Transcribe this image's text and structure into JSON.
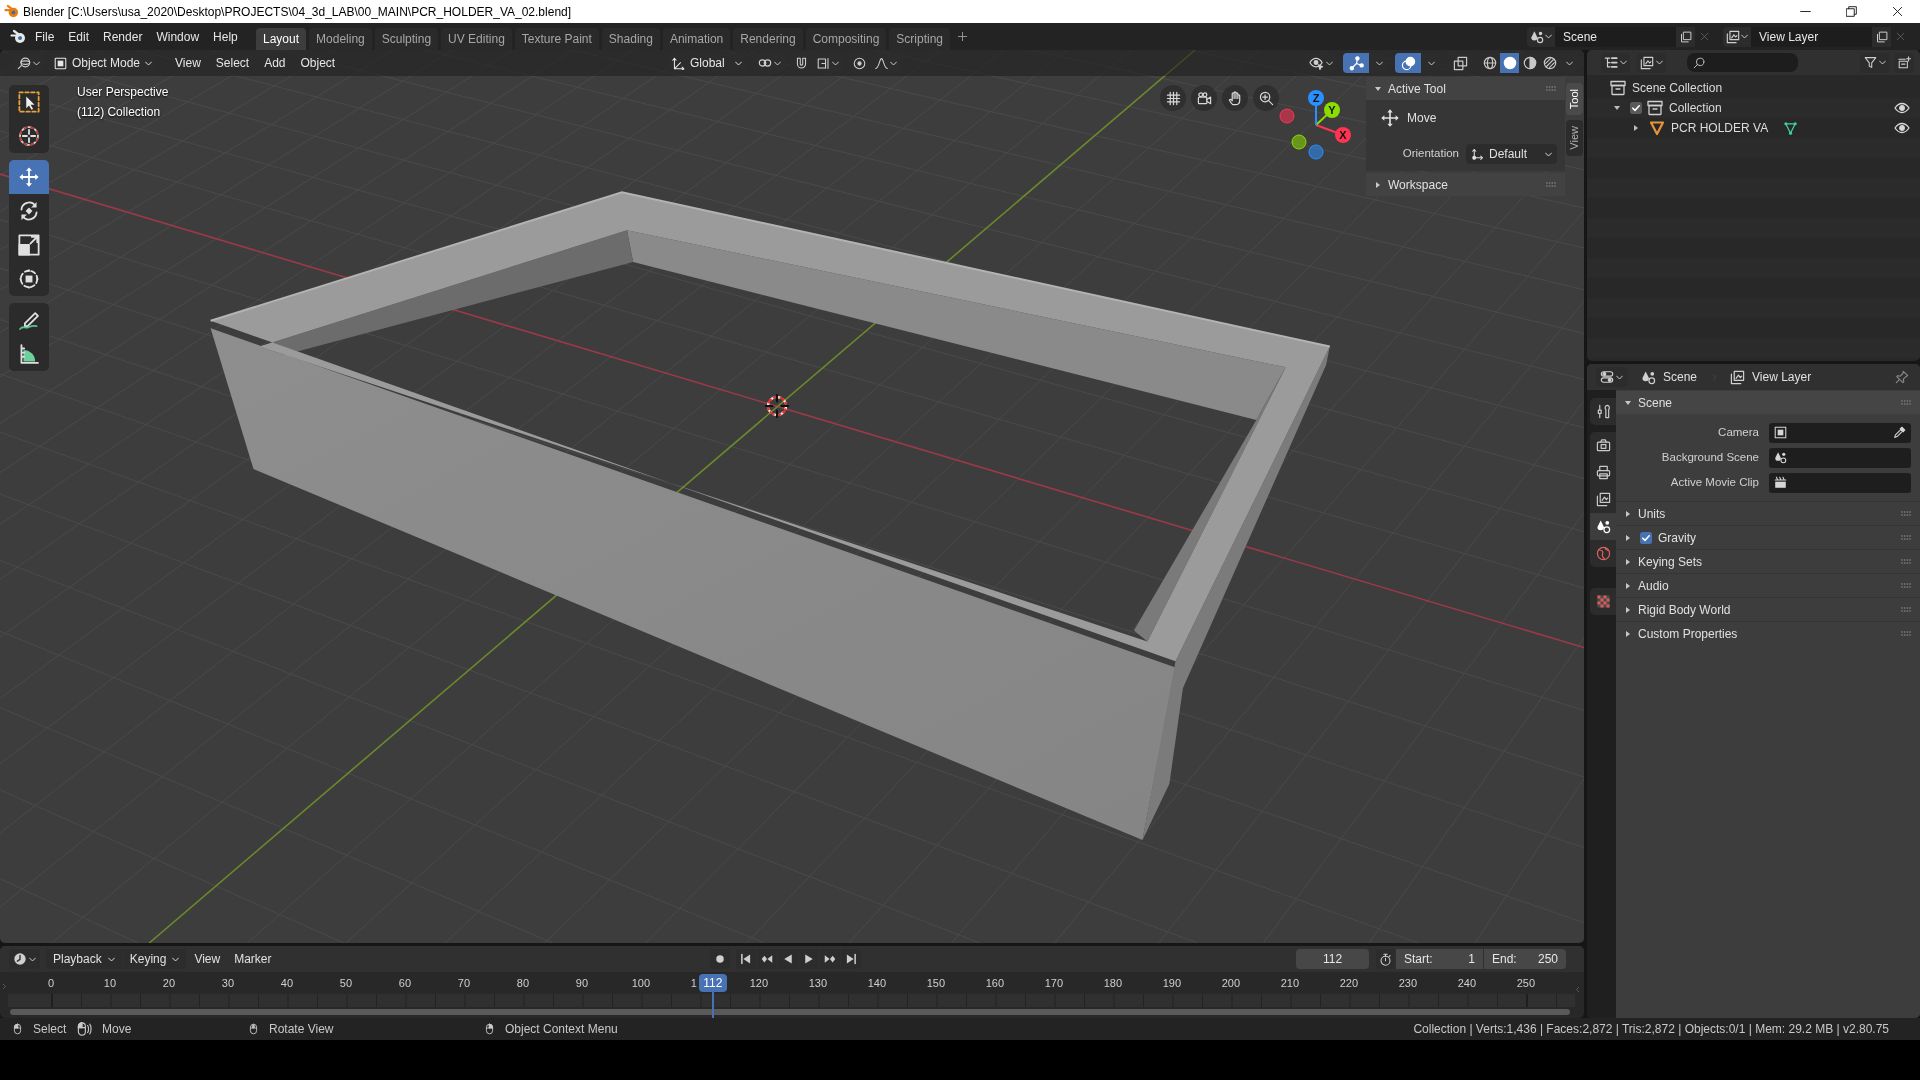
{
  "window": {
    "title": "Blender [C:\\Users\\usa_2020\\Desktop\\PROJECTS\\04_3d_LAB\\00_MAIN\\PCR_HOLDER_VA_02.blend]"
  },
  "menu": [
    "File",
    "Edit",
    "Render",
    "Window",
    "Help"
  ],
  "workspaces": [
    {
      "label": "Layout",
      "selected": true
    },
    {
      "label": "Modeling",
      "selected": false
    },
    {
      "label": "Sculpting",
      "selected": false
    },
    {
      "label": "UV Editing",
      "selected": false
    },
    {
      "label": "Texture Paint",
      "selected": false
    },
    {
      "label": "Shading",
      "selected": false
    },
    {
      "label": "Animation",
      "selected": false
    },
    {
      "label": "Rendering",
      "selected": false
    },
    {
      "label": "Compositing",
      "selected": false
    },
    {
      "label": "Scripting",
      "selected": false
    }
  ],
  "scene_selector": {
    "value": "Scene"
  },
  "view_layer_selector": {
    "value": "View Layer"
  },
  "viewport": {
    "mode": "Object Mode",
    "menus": [
      "View",
      "Select",
      "Add",
      "Object"
    ],
    "orientation": "Global",
    "toggles": [
      {
        "kind": "gizmos",
        "on": true
      },
      {
        "kind": "overlays",
        "on": true
      },
      {
        "kind": "xray",
        "on": false
      }
    ],
    "shading": [
      {
        "kind": "wireframe",
        "selected": false
      },
      {
        "kind": "solid",
        "selected": true
      },
      {
        "kind": "material",
        "selected": false
      },
      {
        "kind": "rendered",
        "selected": false
      }
    ],
    "tool_groups": [
      [
        {
          "kind": "select-box",
          "selected": false
        },
        {
          "kind": "cursor",
          "selected": false
        }
      ],
      [
        {
          "kind": "move",
          "selected": true
        },
        {
          "kind": "rotate",
          "selected": false
        },
        {
          "kind": "scale",
          "selected": false
        },
        {
          "kind": "transform",
          "selected": false
        }
      ],
      [
        {
          "kind": "annotate",
          "selected": false
        },
        {
          "kind": "measure",
          "selected": false
        }
      ]
    ],
    "info": [
      "User Perspective",
      "(112) Collection"
    ],
    "navigation_gizmo": [
      {
        "label": "X",
        "color": "#ff3352"
      },
      {
        "label": "Y",
        "color": "#8bdc00"
      },
      {
        "label": "Z",
        "color": "#2890ff"
      }
    ],
    "sidebar": {
      "tabs": [
        {
          "label": "Tool",
          "selected": true
        },
        {
          "label": "View",
          "selected": false
        }
      ],
      "panels": [
        {
          "title": "Active Tool",
          "expanded": true,
          "tool": "Move",
          "fields": [
            {
              "label": "Orientation",
              "value": "Default"
            }
          ]
        },
        {
          "title": "Workspace",
          "expanded": false
        }
      ]
    }
  },
  "outliner": {
    "tree": [
      {
        "label": "Scene Collection",
        "kind": "scene-collection",
        "children": [
          {
            "label": "Collection",
            "kind": "collection",
            "expanded": true,
            "checked": true,
            "visible": true,
            "children": [
              {
                "label": "PCR HOLDER VA",
                "kind": "mesh-object",
                "expanded": false,
                "visible": true
              }
            ]
          }
        ]
      }
    ]
  },
  "properties": {
    "breadcrumb": [
      {
        "kind": "scene",
        "label": "Scene"
      },
      {
        "kind": "view-layer",
        "label": "View Layer"
      }
    ],
    "tab_groups": [
      [
        {
          "kind": "tool",
          "selected": false
        }
      ],
      [
        {
          "kind": "render",
          "selected": false
        },
        {
          "kind": "output",
          "selected": false
        },
        {
          "kind": "view-layer",
          "selected": false
        },
        {
          "kind": "scene",
          "selected": true
        },
        {
          "kind": "world",
          "selected": false
        }
      ],
      [
        {
          "kind": "texture",
          "selected": false
        }
      ]
    ],
    "panels": [
      {
        "title": "Scene",
        "expanded": true,
        "fields": [
          {
            "label": "Camera",
            "kind": "camera"
          },
          {
            "label": "Background Scene",
            "kind": "scene"
          },
          {
            "label": "Active Movie Clip",
            "kind": "movie-clip"
          }
        ]
      },
      {
        "title": "Units",
        "expanded": false
      },
      {
        "title": "Gravity",
        "expanded": false,
        "checked": true
      },
      {
        "title": "Keying Sets",
        "expanded": false
      },
      {
        "title": "Audio",
        "expanded": false
      },
      {
        "title": "Rigid Body World",
        "expanded": false
      },
      {
        "title": "Custom Properties",
        "expanded": false
      }
    ]
  },
  "timeline": {
    "menus": [
      {
        "label": "Playback",
        "kind": "dropdown"
      },
      {
        "label": "Keying",
        "kind": "dropdown"
      },
      {
        "label": "View",
        "kind": "menu"
      },
      {
        "label": "Marker",
        "kind": "menu"
      }
    ],
    "auto_keying": false,
    "current_frame": "112",
    "start": {
      "label": "Start:",
      "value": "1"
    },
    "end": {
      "label": "End:",
      "value": "250"
    },
    "ruler_labels": [
      "0",
      "10",
      "20",
      "30",
      "40",
      "50",
      "60",
      "70",
      "80",
      "90",
      "100",
      "1",
      "120",
      "130",
      "140",
      "150",
      "160",
      "170",
      "180",
      "190",
      "200",
      "210",
      "220",
      "230",
      "240",
      "250"
    ],
    "playhead": "112"
  },
  "status_bar": {
    "hints": [
      {
        "kind": "mouse-left",
        "label": "Select"
      },
      {
        "kind": "mouse-drag",
        "label": "Move"
      },
      {
        "kind": "mouse-middle",
        "label": "Rotate View"
      },
      {
        "kind": "mouse-right",
        "label": "Object Context Menu"
      }
    ],
    "stats": "Collection | Verts:1,436 | Faces:2,872 | Tris:2,872 | Objects:0/1 | Mem: 29.2 MB | v2.80.75"
  }
}
